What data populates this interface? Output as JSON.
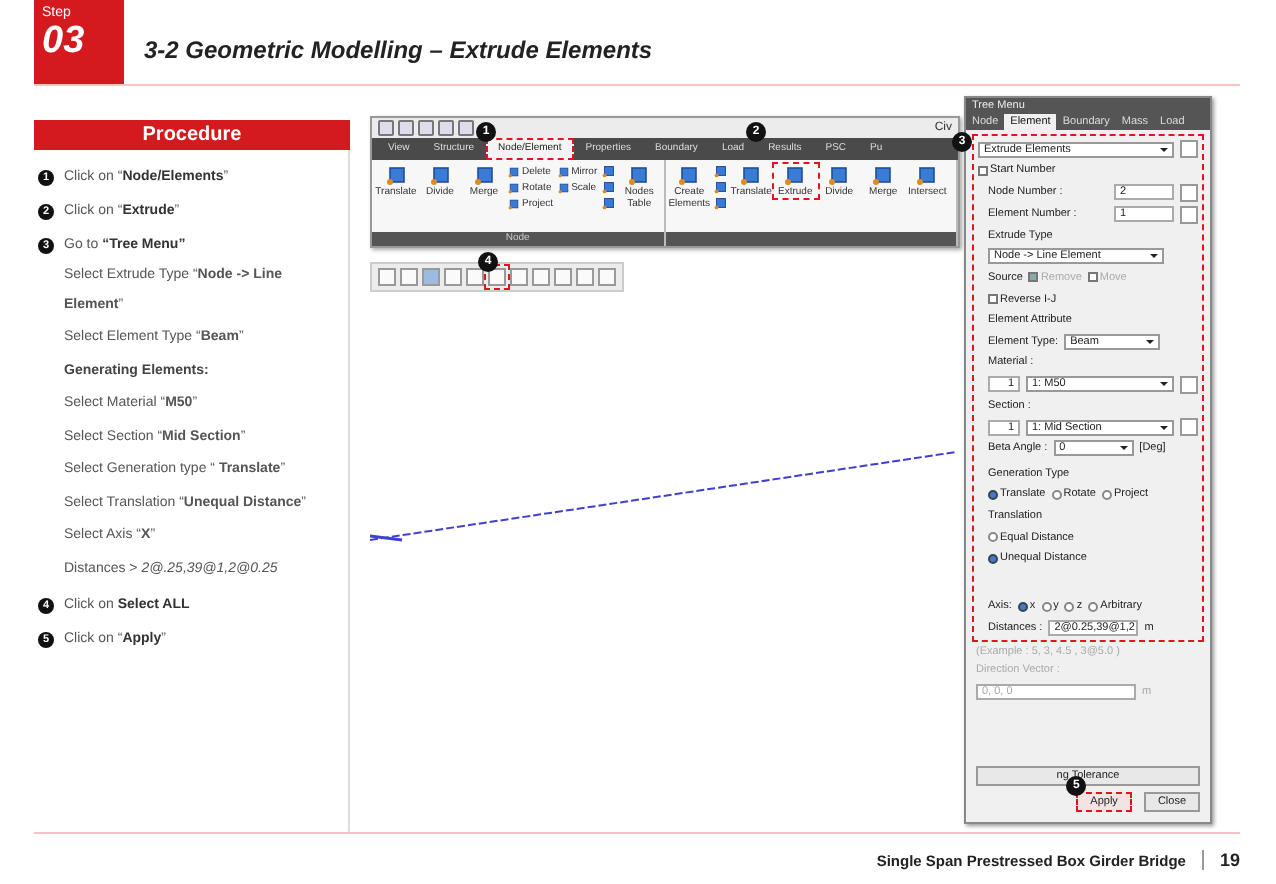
{
  "header": {
    "step_label": "Step",
    "step_number": "03",
    "title": "3-2 Geometric Modelling – Extrude Elements"
  },
  "procedure": {
    "title": "Procedure",
    "steps": [
      {
        "number": "1",
        "text": "Click on “**Node/Elements**”"
      },
      {
        "number": "2",
        "text": "Click on “**Extrude**”"
      },
      {
        "number": "3",
        "text": "Go to **“Tree Menu”**",
        "substeps": [
          {
            "kind": "text",
            "text": "Select Extrude Type “**Node -> Line Element**”"
          },
          {
            "kind": "text",
            "text": "Select Element Type “**Beam**”"
          },
          {
            "kind": "heading",
            "text": "Generating Elements:"
          },
          {
            "kind": "text",
            "text": "Select Material “**M50**”"
          },
          {
            "kind": "text",
            "text": "Select Section “**Mid Section**”"
          },
          {
            "kind": "text",
            "text": "Select Generation type “ **Translate**”"
          },
          {
            "kind": "text",
            "text": "Select Translation “**Unequal Distance**”"
          },
          {
            "kind": "text",
            "text": "Select Axis “**X**”"
          },
          {
            "kind": "text",
            "text": "Distances > *2@.25,39@1,2@0.25*"
          }
        ]
      },
      {
        "number": "4",
        "text": "Click on **Select ALL**"
      },
      {
        "number": "5",
        "text": "Click on “**Apply**”"
      }
    ]
  },
  "ribbon": {
    "window_title": "Civ",
    "tabs": [
      {
        "label": "View",
        "selected": false
      },
      {
        "label": "Structure",
        "selected": false
      },
      {
        "label": "Node/Element",
        "selected": true,
        "callout": "1"
      },
      {
        "label": "Properties",
        "selected": false
      },
      {
        "label": "Boundary",
        "selected": false
      },
      {
        "label": "Load",
        "selected": false
      },
      {
        "label": "Results",
        "selected": false,
        "callout": "2"
      },
      {
        "label": "PSC",
        "selected": false
      },
      {
        "label": "Pu",
        "selected": false
      }
    ],
    "groups": [
      {
        "label": "Node",
        "buttons": [
          {
            "kind": "large",
            "label": "Translate"
          },
          {
            "kind": "large",
            "label": "Divide"
          },
          {
            "kind": "large",
            "label": "Merge"
          },
          {
            "kind": "small",
            "label": "Delete"
          },
          {
            "kind": "small",
            "label": "Rotate"
          },
          {
            "kind": "small",
            "label": "Project"
          },
          {
            "kind": "small",
            "label": "Mirror"
          },
          {
            "kind": "small",
            "label": "Scale"
          },
          {
            "kind": "icon"
          },
          {
            "kind": "icon"
          },
          {
            "kind": "icon"
          },
          {
            "kind": "large",
            "label": "Nodes Table"
          }
        ]
      },
      {
        "buttons": [
          {
            "kind": "large",
            "label": "Create Elements"
          },
          {
            "kind": "icon"
          },
          {
            "kind": "icon"
          },
          {
            "kind": "icon"
          },
          {
            "kind": "large",
            "label": "Translate"
          },
          {
            "kind": "large",
            "label": "Extrude",
            "highlighted": true
          },
          {
            "kind": "large",
            "label": "Divide"
          },
          {
            "kind": "large",
            "label": "Merge"
          },
          {
            "kind": "large",
            "label": "Intersect"
          }
        ]
      }
    ]
  },
  "toolbar": {
    "buttons": [
      {
        "pressed": false
      },
      {
        "pressed": false
      },
      {
        "pressed": true
      },
      {
        "pressed": false
      },
      {
        "pressed": false
      },
      {
        "pressed": false,
        "callout": "4"
      },
      {
        "pressed": false
      },
      {
        "pressed": false
      },
      {
        "pressed": false
      },
      {
        "pressed": false
      },
      {
        "pressed": false
      }
    ]
  },
  "tree_menu": {
    "title": "Tree Menu",
    "callout": "3",
    "tabs": [
      {
        "label": "Node",
        "selected": false
      },
      {
        "label": "Element",
        "selected": true
      },
      {
        "label": "Boundary",
        "selected": false
      },
      {
        "label": "Mass",
        "selected": false
      },
      {
        "label": "Load",
        "selected": false
      }
    ],
    "function": "Extrude Elements",
    "start_number": {
      "label": "Start Number",
      "checked": false
    },
    "node_number": {
      "label": "Node Number  :",
      "value": "2"
    },
    "element_number": {
      "label": "Element Number :",
      "value": "1"
    },
    "extrude_type": {
      "label": "Extrude Type",
      "value": "Node -> Line Element"
    },
    "source": {
      "label": "Source",
      "options": [
        {
          "label": "Remove",
          "checked": true
        },
        {
          "label": "Move",
          "checked": false
        }
      ]
    },
    "reverse": {
      "label": "Reverse I-J",
      "checked": false
    },
    "element_attribute": {
      "label": "Element Attribute",
      "type_label": "Element Type:",
      "type": "Beam",
      "material_label": "Material :",
      "material_number": "1",
      "material": "1: M50",
      "section_label": "Section :",
      "section_number": "1",
      "section": "1: Mid Section",
      "beta_label": "Beta Angle :",
      "beta": "0",
      "beta_unit": "[Deg]"
    },
    "generation_type": {
      "label": "Generation Type",
      "options": [
        {
          "label": "Translate",
          "selected": true
        },
        {
          "label": "Rotate",
          "selected": false
        },
        {
          "label": "Project",
          "selected": false
        }
      ]
    },
    "translation": {
      "label": "Translation",
      "options": [
        {
          "label": "Equal Distance",
          "selected": false
        },
        {
          "label": "Unequal Distance",
          "selected": true
        }
      ]
    },
    "axis": {
      "label": "Axis:",
      "options": [
        {
          "label": "x",
          "selected": true
        },
        {
          "label": "y",
          "selected": false
        },
        {
          "label": "z",
          "selected": false
        },
        {
          "label": "Arbitrary",
          "selected": false
        }
      ]
    },
    "distances": {
      "label": "Distances :",
      "value": "2@0.25,39@1,2",
      "unit": "m"
    },
    "example": "(Example : 5, 3, 4.5 , 3@5.0 )",
    "direction_vector": {
      "label": "Direction Vector :",
      "value": "0, 0, 0",
      "unit": "m",
      "disabled": true
    },
    "tolerance_button": "ng Tolerance",
    "buttons": [
      {
        "label": "Apply",
        "highlighted": true,
        "callout": "5"
      },
      {
        "label": "Close",
        "highlighted": false
      }
    ]
  },
  "footer": {
    "title": "Single Span Prestressed Box Girder Bridge",
    "page": "19"
  }
}
